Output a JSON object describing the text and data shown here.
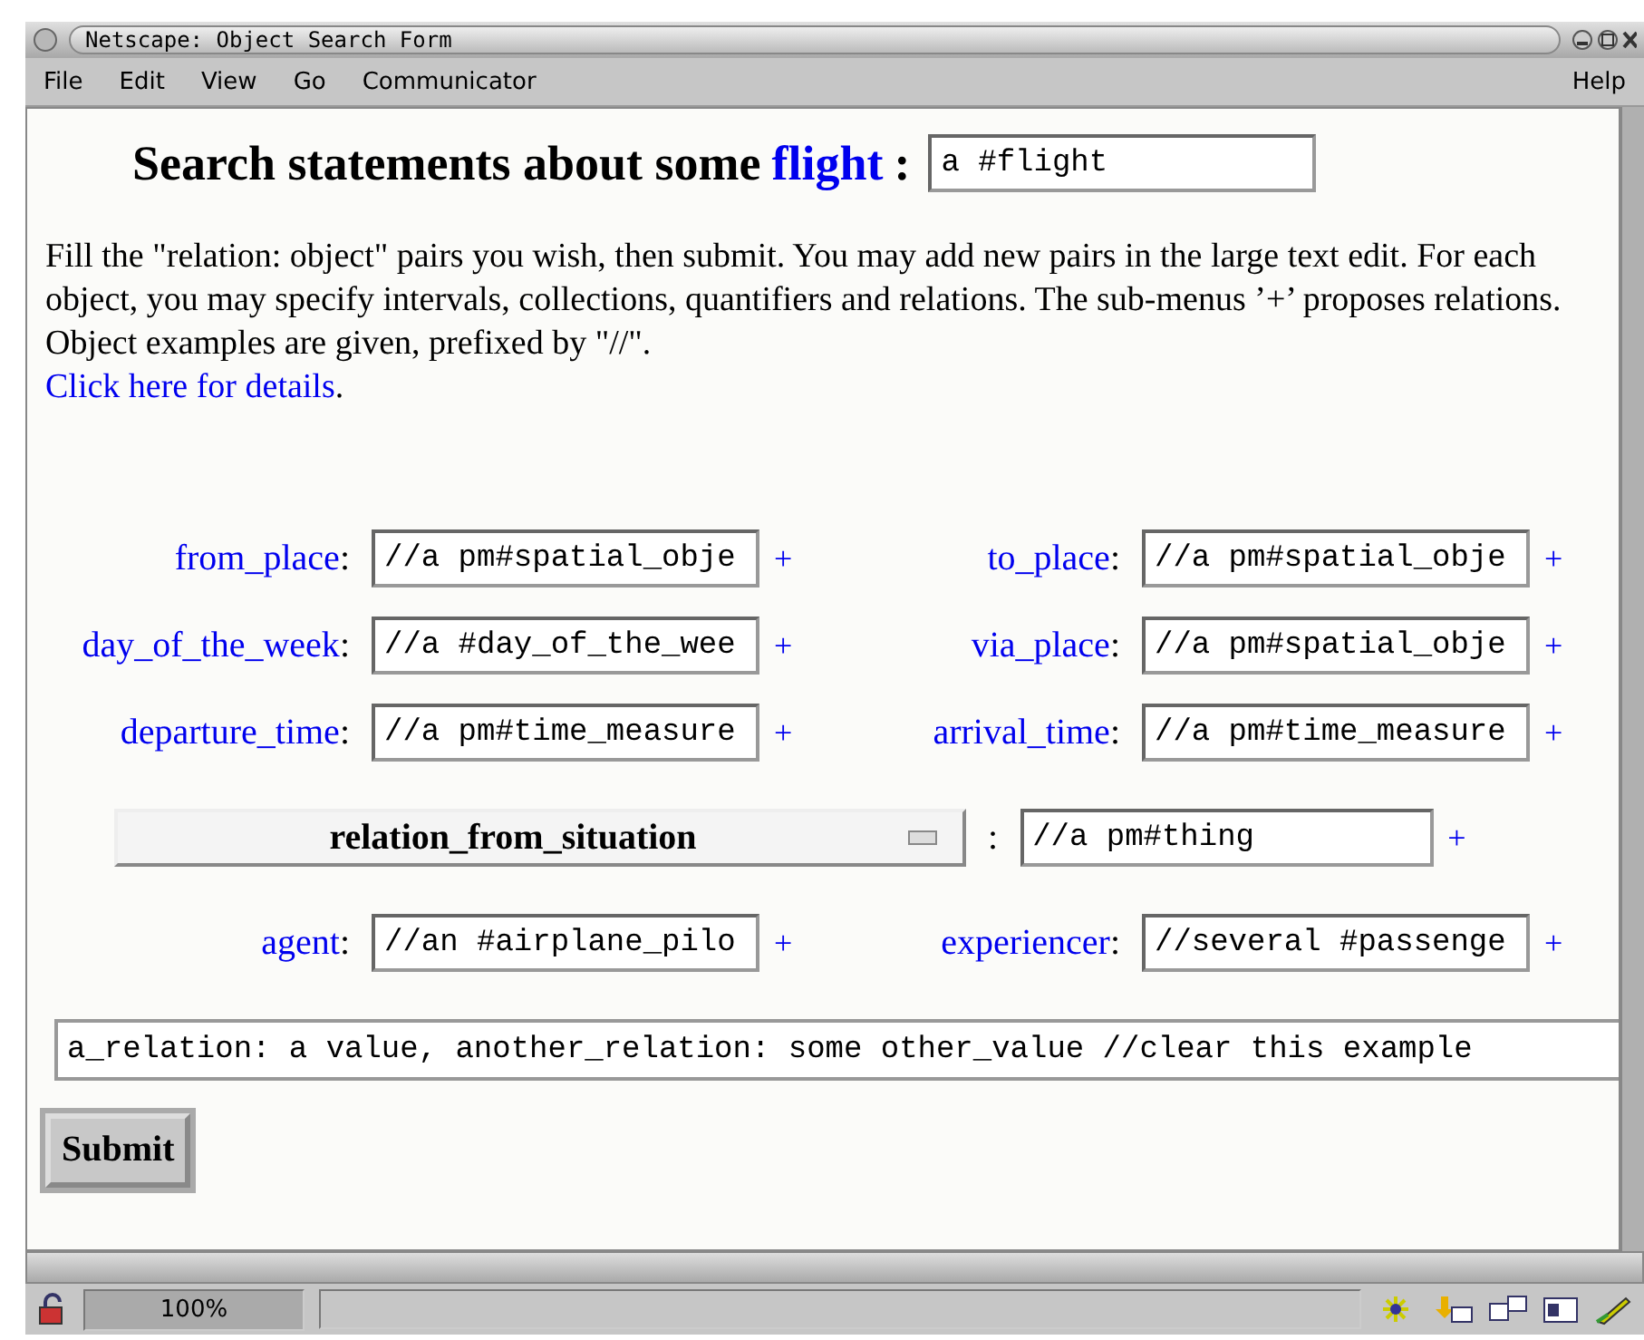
{
  "window": {
    "title": "Netscape: Object Search Form"
  },
  "menu": [
    {
      "label": "File"
    },
    {
      "label": "Edit"
    },
    {
      "label": "View"
    },
    {
      "label": "Go"
    },
    {
      "label": "Communicator"
    }
  ],
  "help_menu": {
    "label": "Help"
  },
  "heading": {
    "text": "Search statements about some",
    "link": "flight",
    "suffix": ":",
    "field_value": "a #flight"
  },
  "intro": {
    "text": "Fill the \"relation: object\" pairs you wish, then submit. You may add new pairs in the large text edit. For each object, you may specify intervals, collections, quantifiers and relations. The sub-menus ’+’ proposes relations. Object examples are given, prefixed by \"//\".",
    "link": "Click here for details",
    "suffix": "."
  },
  "pairs": [
    [
      {
        "label": "from_place",
        "colon": ":",
        "value": "//a pm#spatial_obje",
        "add": "+"
      },
      {
        "label": "to_place",
        "colon": ":",
        "value": "//a pm#spatial_obje",
        "add": "+"
      }
    ],
    [
      {
        "label": "day_of_the_week",
        "colon": ":",
        "value": "//a #day_of_the_wee",
        "add": "+"
      },
      {
        "label": "via_place",
        "colon": ":",
        "value": "//a pm#spatial_obje",
        "add": "+"
      }
    ],
    [
      {
        "label": "departure_time",
        "colon": ":",
        "value": "//a pm#time_measure",
        "add": "+"
      },
      {
        "label": "arrival_time",
        "colon": ":",
        "value": "//a pm#time_measure",
        "add": "+"
      }
    ]
  ],
  "relation": {
    "select": "relation_from_situation",
    "separator": ":",
    "value": "//a pm#thing",
    "add": "+"
  },
  "agents": [
    {
      "label": "agent",
      "colon": ":",
      "value": "//an #airplane_pilo",
      "add": "+"
    },
    {
      "label": "experiencer",
      "colon": ":",
      "value": "//several #passenge",
      "add": "+"
    }
  ],
  "free_text": {
    "value": "a_relation: a value, another_relation: some other_value //clear this example"
  },
  "submit": {
    "label": "Submit"
  },
  "status_bar": {
    "zoom": "100%"
  }
}
